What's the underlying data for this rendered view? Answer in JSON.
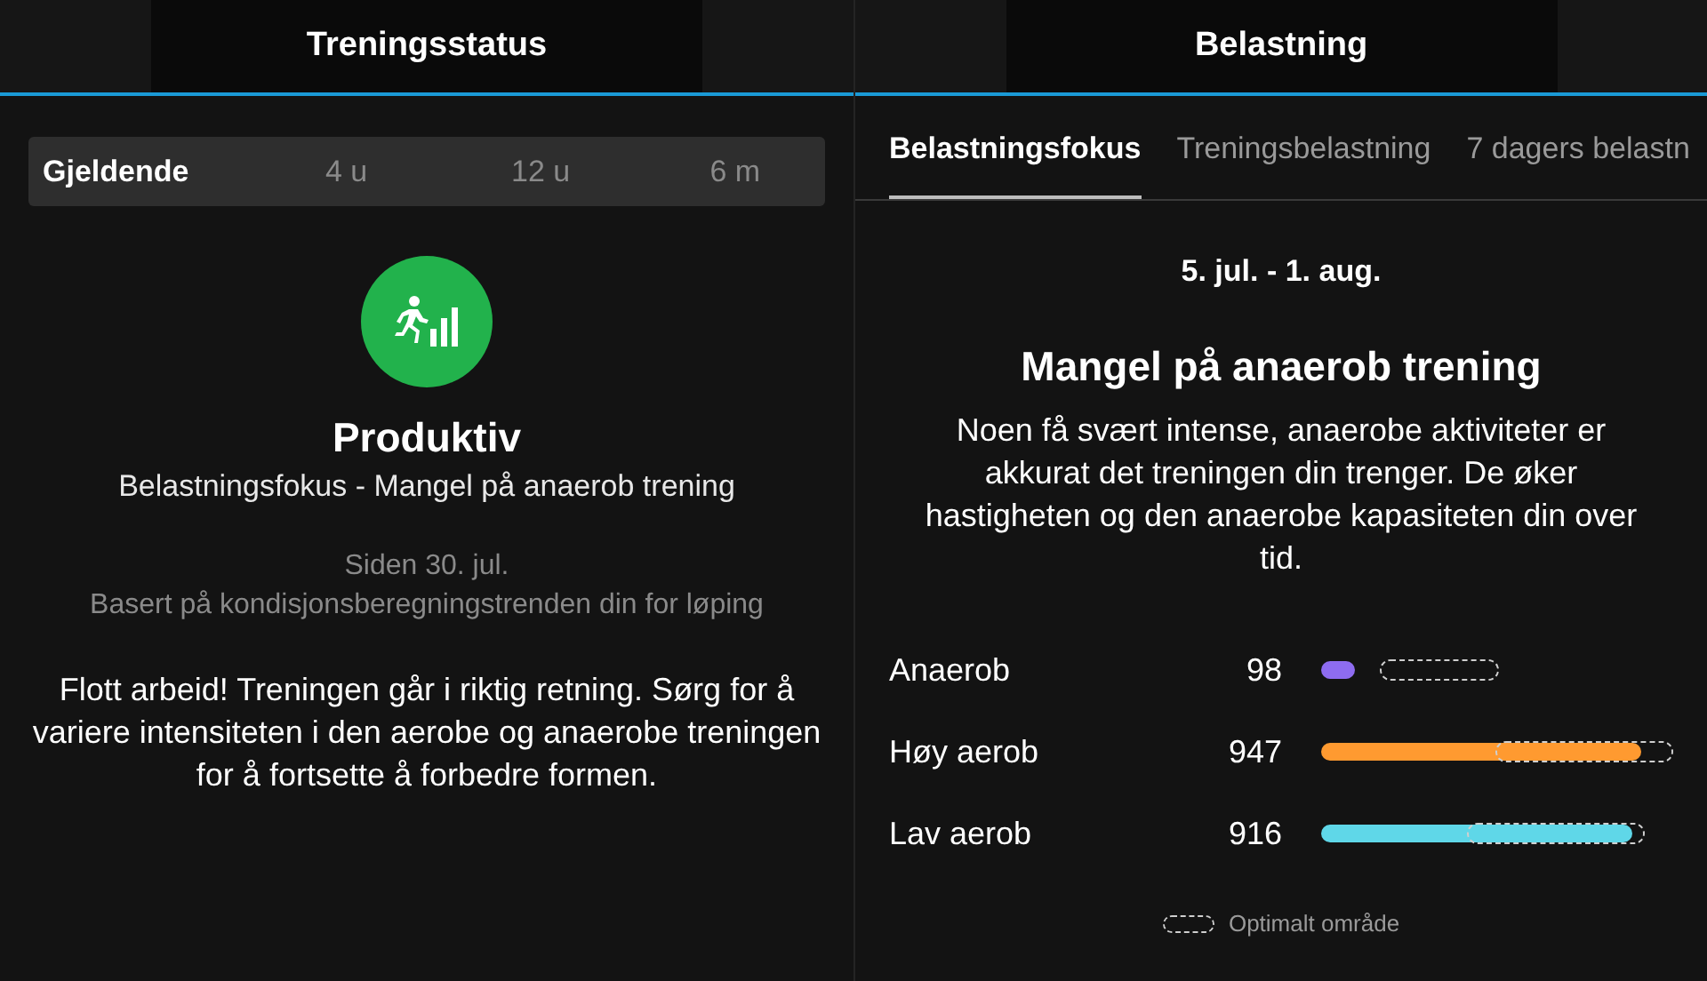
{
  "left": {
    "title": "Treningsstatus",
    "periods": [
      {
        "label": "Gjeldende",
        "selected": true
      },
      {
        "label": "4 u",
        "selected": false
      },
      {
        "label": "12 u",
        "selected": false
      },
      {
        "label": "6 m",
        "selected": false
      }
    ],
    "status": "Produktiv",
    "subtitle": "Belastningsfokus - Mangel på anaerob trening",
    "since": "Siden 30. jul.",
    "basis": "Basert på kondisjonsberegningstrenden din for løping",
    "message": "Flott arbeid! Treningen går i riktig retning. Sørg for å variere intensiteten i den aerobe og anaerobe treningen for å fortsette å forbedre formen."
  },
  "right": {
    "title": "Belastning",
    "tabs": [
      {
        "label": "Belastningsfokus",
        "selected": true
      },
      {
        "label": "Treningsbelastning",
        "selected": false
      },
      {
        "label": "7 dagers belastn",
        "selected": false
      }
    ],
    "date_range": "5. jul. - 1. aug.",
    "heading": "Mangel på anaerob trening",
    "description": "Noen få svært intense, anaerobe aktiviteter er akkurat det treningen din trenger. De øker hastigheten og den anaerobe kapasiteten din over tid.",
    "loads": [
      {
        "label": "Anaerob",
        "value": "98",
        "color": "#8e6cf0"
      },
      {
        "label": "Høy aerob",
        "value": "947",
        "color": "#ff9a30"
      },
      {
        "label": "Lav aerob",
        "value": "916",
        "color": "#5fd7e8"
      }
    ],
    "legend": "Optimalt område"
  }
}
